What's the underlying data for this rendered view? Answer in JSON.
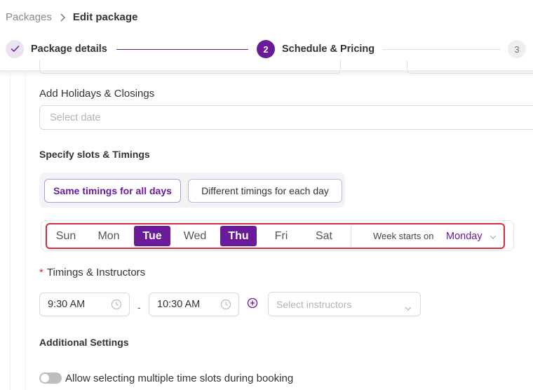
{
  "breadcrumb": {
    "parent": "Packages",
    "current": "Edit package"
  },
  "stepper": {
    "steps": [
      {
        "number": "",
        "label": "Package details",
        "state": "done"
      },
      {
        "number": "2",
        "label": "Schedule & Pricing",
        "state": "active"
      },
      {
        "number": "3",
        "label": "",
        "state": "pending"
      }
    ]
  },
  "holidays": {
    "label": "Add Holidays & Closings",
    "placeholder": "Select date"
  },
  "slots": {
    "title": "Specify slots & Timings",
    "modes": [
      {
        "label": "Same timings for all days",
        "selected": true
      },
      {
        "label": "Different timings for each day",
        "selected": false
      }
    ]
  },
  "days": [
    {
      "label": "Sun",
      "selected": false
    },
    {
      "label": "Mon",
      "selected": false
    },
    {
      "label": "Tue",
      "selected": true
    },
    {
      "label": "Wed",
      "selected": false
    },
    {
      "label": "Thu",
      "selected": true
    },
    {
      "label": "Fri",
      "selected": false
    },
    {
      "label": "Sat",
      "selected": false
    }
  ],
  "week_start": {
    "label": "Week starts on",
    "value": "Monday"
  },
  "timings": {
    "label": "Timings & Instructors",
    "required_mark": "*",
    "start": "9:30 AM",
    "separator": "-",
    "end": "10:30 AM",
    "instructors_placeholder": "Select instructors"
  },
  "additional": {
    "title": "Additional Settings",
    "multi_slot_label": "Allow selecting multiple time slots during booking",
    "multi_slot_enabled": false
  },
  "colors": {
    "accent": "#6a1b9a",
    "highlight": "#d62d3c"
  }
}
